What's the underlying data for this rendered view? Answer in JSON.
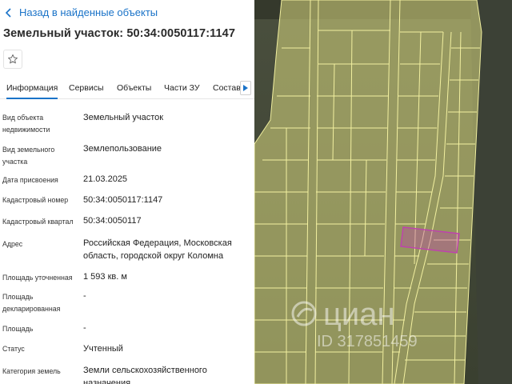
{
  "back_link": {
    "label": "Назад в найденные объекты"
  },
  "page_title": "Земельный участок: 50:34:0050117:1147",
  "tabs": [
    {
      "label": "Информация",
      "active": true
    },
    {
      "label": "Сервисы",
      "active": false
    },
    {
      "label": "Объекты",
      "active": false
    },
    {
      "label": "Части ЗУ",
      "active": false
    },
    {
      "label": "Состав",
      "active": false
    }
  ],
  "fields": [
    {
      "label": "Вид объекта недвижимости",
      "value": "Земельный участок"
    },
    {
      "label": "Вид земельного участка",
      "value": "Землепользование"
    },
    {
      "label": "Дата присвоения",
      "value": "21.03.2025"
    },
    {
      "label": "Кадастровый номер",
      "value": "50:34:0050117:1147"
    },
    {
      "label": "Кадастровый квартал",
      "value": "50:34:0050117"
    },
    {
      "label": "Адрес",
      "value": "Российская Федерация, Московская область, городской округ Коломна"
    },
    {
      "label": "Площадь уточненная",
      "value": "1 593 кв. м"
    },
    {
      "label": "Площадь декларированная",
      "value": "-"
    },
    {
      "label": "Площадь",
      "value": "-"
    },
    {
      "label": "Статус",
      "value": "Учтенный"
    },
    {
      "label": "Категория земель",
      "value": "Земли сельскохозяйственного назначения"
    }
  ],
  "watermark": {
    "brand": "циан",
    "id_text": "ID 317851459"
  },
  "colors": {
    "accent": "#1a73c8",
    "parcel_fill": "#c8c878",
    "parcel_line": "#f2f0a0",
    "selected_parcel": "#c040b0"
  },
  "icons": [
    "chevron-left-icon",
    "star-icon",
    "chevron-right-icon",
    "cian-logo-icon"
  ]
}
